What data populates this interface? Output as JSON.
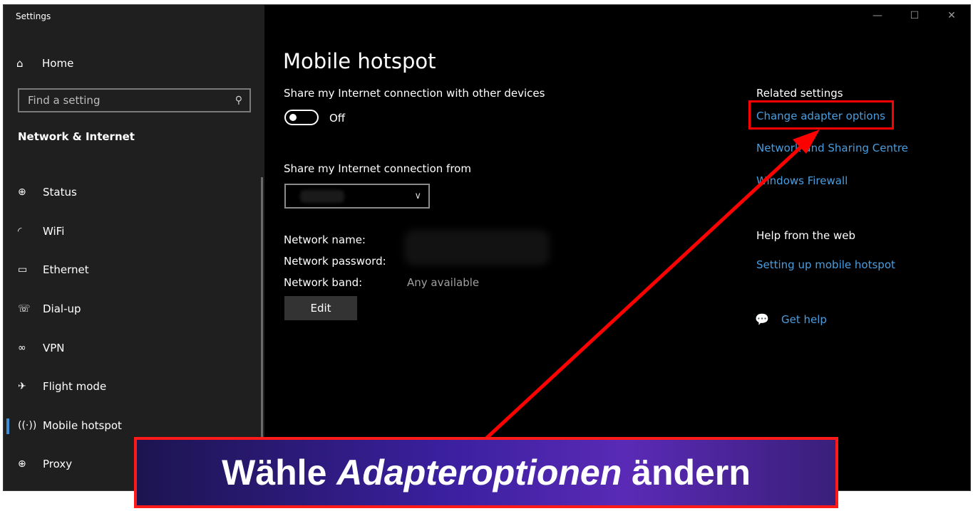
{
  "window": {
    "title": "Settings",
    "controls": [
      "—",
      "☐",
      "✕"
    ]
  },
  "sidebar": {
    "home_label": "Home",
    "search_placeholder": "Find a setting",
    "section_title": "Network & Internet",
    "items": [
      {
        "label": "Status",
        "icon": "globe-icon"
      },
      {
        "label": "WiFi",
        "icon": "wifi-icon"
      },
      {
        "label": "Ethernet",
        "icon": "ethernet-icon"
      },
      {
        "label": "Dial-up",
        "icon": "dialup-icon"
      },
      {
        "label": "VPN",
        "icon": "vpn-icon"
      },
      {
        "label": "Flight mode",
        "icon": "airplane-icon"
      },
      {
        "label": "Mobile hotspot",
        "icon": "hotspot-icon"
      },
      {
        "label": "Proxy",
        "icon": "globe-icon"
      }
    ],
    "active_item": "Mobile hotspot"
  },
  "main": {
    "title": "Mobile hotspot",
    "share_label": "Share my Internet connection with other devices",
    "toggle_state": "Off",
    "from_label": "Share my Internet connection from",
    "network_name_label": "Network name:",
    "network_password_label": "Network password:",
    "network_band_label": "Network band:",
    "network_band_value": "Any available",
    "edit_button": "Edit"
  },
  "related": {
    "heading": "Related settings",
    "links": [
      "Change adapter options",
      "Network and Sharing Centre",
      "Windows Firewall"
    ],
    "help_heading": "Help from the web",
    "help_link": "Setting up mobile hotspot",
    "get_help": "Get help"
  },
  "banner": {
    "text_plain": "Wähle ",
    "text_italic": "Adapteroptionen",
    "text_end": " ändern"
  },
  "colors": {
    "accent": "#4a9ee0",
    "annotation": "#ff0000"
  }
}
